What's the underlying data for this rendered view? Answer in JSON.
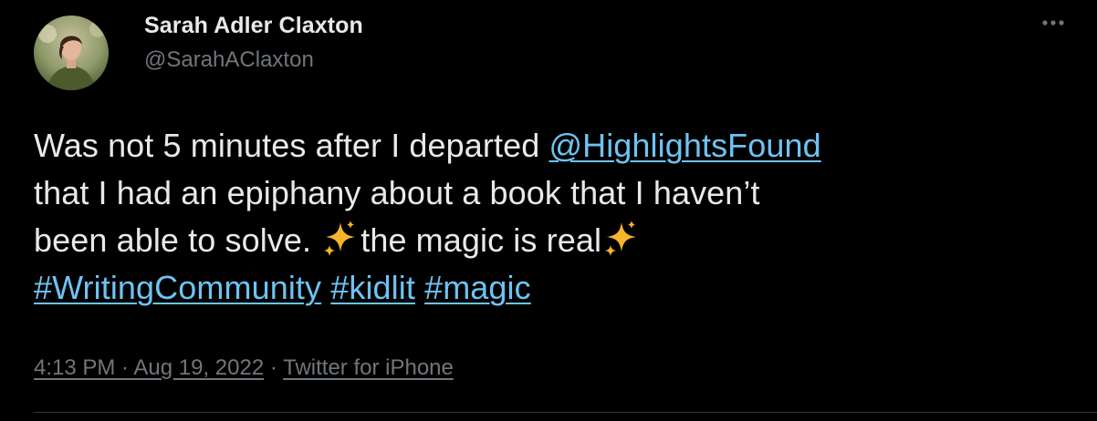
{
  "author": {
    "name": "Sarah Adler Claxton",
    "handle": "@SarahAClaxton"
  },
  "tweet": {
    "line1_text": "Was not 5 minutes after I departed ",
    "line1_mention": "@HighlightsFound",
    "line2_text": "that I had an epiphany about a book that I haven’t",
    "line3_text_a": "been able to solve. ",
    "line3_text_b": "the magic is real",
    "hashtags": [
      "#WritingCommunity",
      "#kidlit",
      "#magic"
    ]
  },
  "meta": {
    "time": "4:13 PM",
    "date": "Aug 19, 2022",
    "separator": " · ",
    "source": "Twitter for iPhone"
  },
  "icons": {
    "more": "more-horizontal-icon",
    "sparkles": "sparkles-emoji"
  },
  "colors": {
    "background": "#000000",
    "text": "#e7e9ea",
    "secondary": "#71767b",
    "link": "#6ec3f2",
    "sparkle": "#f7b52a"
  }
}
